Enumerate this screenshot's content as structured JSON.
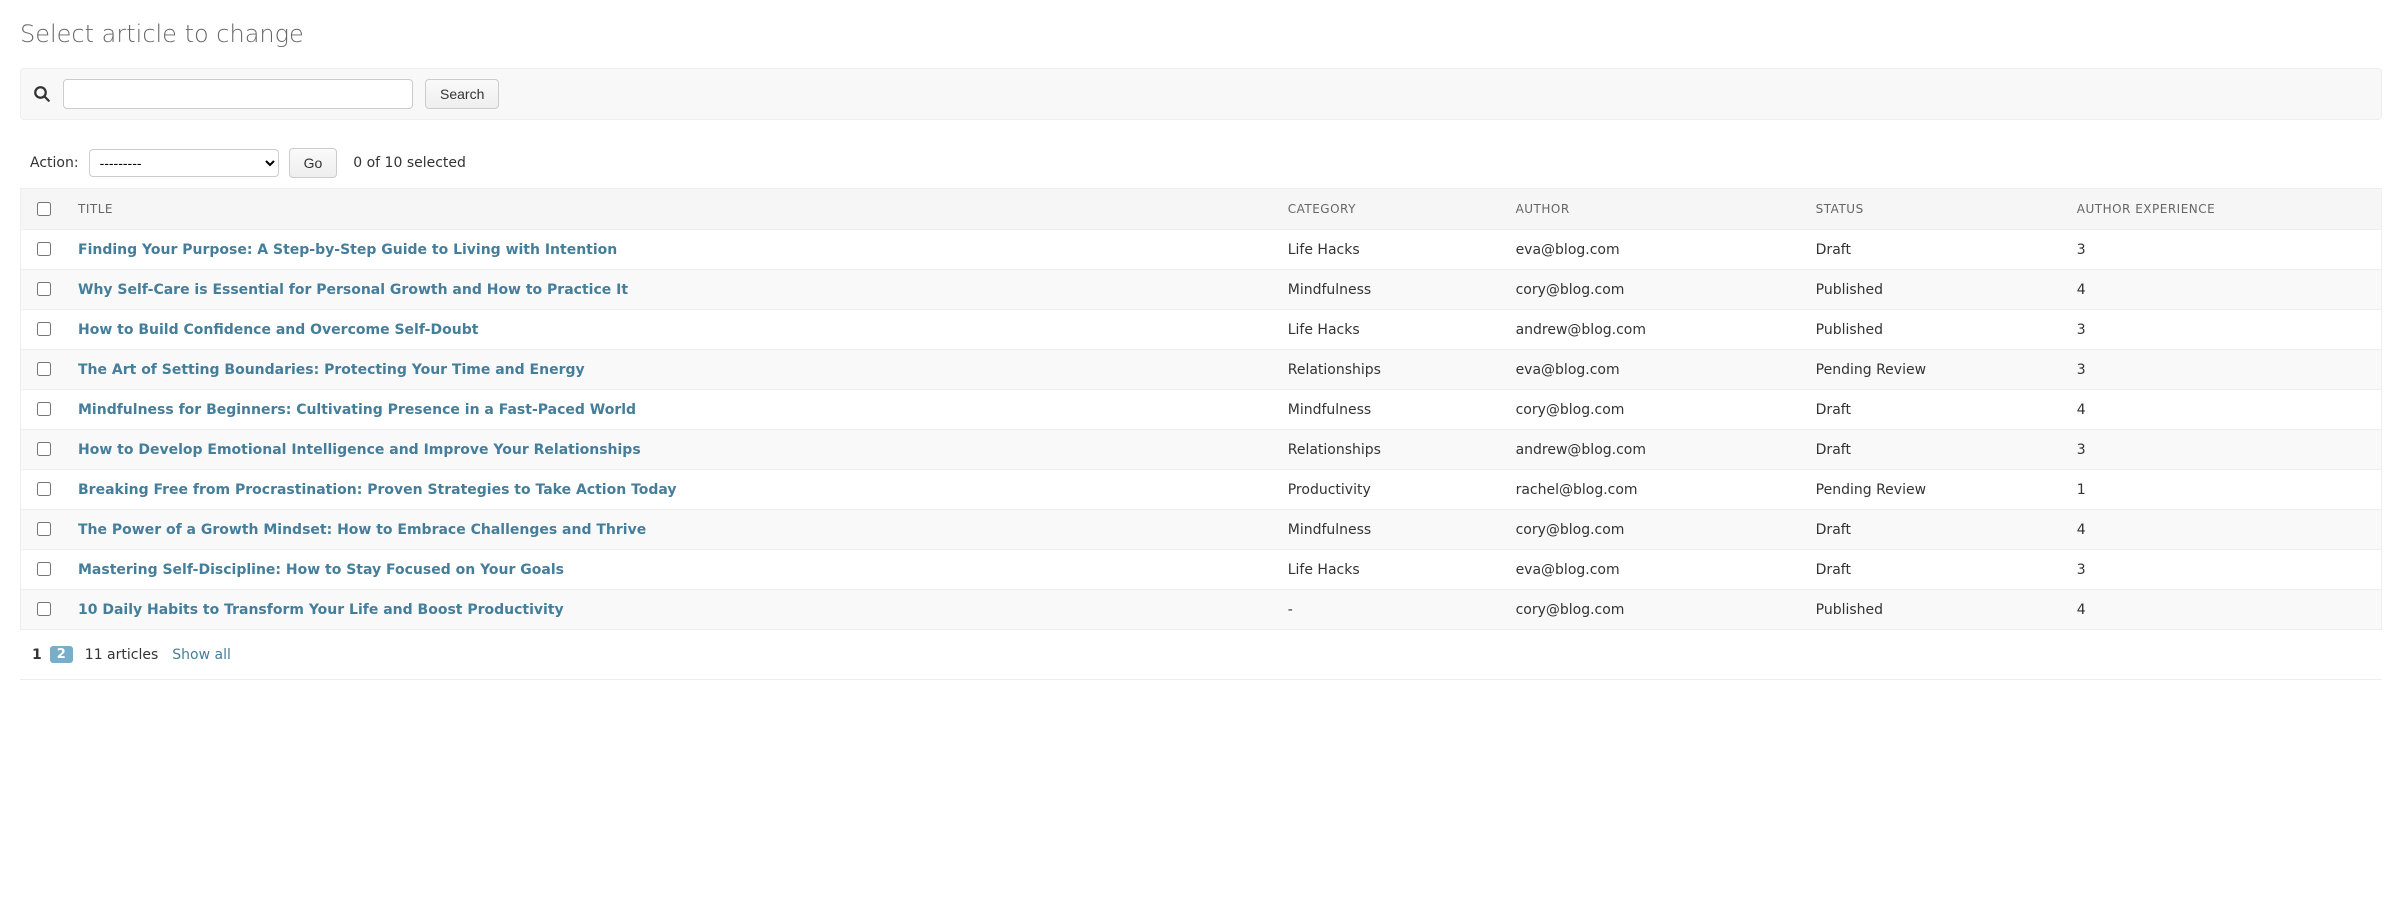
{
  "page_title": "Select article to change",
  "search": {
    "button_label": "Search",
    "input_value": ""
  },
  "actions": {
    "label": "Action:",
    "placeholder_option": "---------",
    "go_label": "Go",
    "selection_text": "0 of 10 selected"
  },
  "columns": {
    "title": "Title",
    "category": "Category",
    "author": "Author",
    "status": "Status",
    "author_experience": "Author Experience"
  },
  "rows": [
    {
      "title": "Finding Your Purpose: A Step-by-Step Guide to Living with Intention",
      "category": "Life Hacks",
      "author": "eva@blog.com",
      "status": "Draft",
      "exp": "3"
    },
    {
      "title": "Why Self-Care is Essential for Personal Growth and How to Practice It",
      "category": "Mindfulness",
      "author": "cory@blog.com",
      "status": "Published",
      "exp": "4"
    },
    {
      "title": "How to Build Confidence and Overcome Self-Doubt",
      "category": "Life Hacks",
      "author": "andrew@blog.com",
      "status": "Published",
      "exp": "3"
    },
    {
      "title": "The Art of Setting Boundaries: Protecting Your Time and Energy",
      "category": "Relationships",
      "author": "eva@blog.com",
      "status": "Pending Review",
      "exp": "3"
    },
    {
      "title": "Mindfulness for Beginners: Cultivating Presence in a Fast-Paced World",
      "category": "Mindfulness",
      "author": "cory@blog.com",
      "status": "Draft",
      "exp": "4"
    },
    {
      "title": "How to Develop Emotional Intelligence and Improve Your Relationships",
      "category": "Relationships",
      "author": "andrew@blog.com",
      "status": "Draft",
      "exp": "3"
    },
    {
      "title": "Breaking Free from Procrastination: Proven Strategies to Take Action Today",
      "category": "Productivity",
      "author": "rachel@blog.com",
      "status": "Pending Review",
      "exp": "1"
    },
    {
      "title": "The Power of a Growth Mindset: How to Embrace Challenges and Thrive",
      "category": "Mindfulness",
      "author": "cory@blog.com",
      "status": "Draft",
      "exp": "4"
    },
    {
      "title": "Mastering Self-Discipline: How to Stay Focused on Your Goals",
      "category": "Life Hacks",
      "author": "eva@blog.com",
      "status": "Draft",
      "exp": "3"
    },
    {
      "title": "10 Daily Habits to Transform Your Life and Boost Productivity",
      "category": "-",
      "author": "cory@blog.com",
      "status": "Published",
      "exp": "4"
    }
  ],
  "paginator": {
    "current_page": "1",
    "other_page": "2",
    "count_text": "11 articles",
    "show_all": "Show all"
  }
}
